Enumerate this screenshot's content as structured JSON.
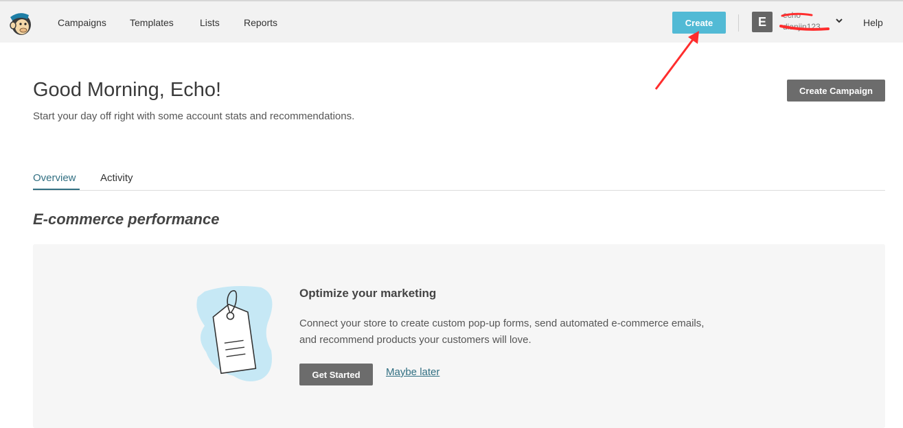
{
  "nav": {
    "logo_icon": "mailchimp-freddie-logo",
    "links": [
      "Campaigns",
      "Templates",
      "Lists",
      "Reports"
    ],
    "create_label": "Create",
    "account": {
      "avatar_initial": "E",
      "name": "echo",
      "username": "dianjin123"
    },
    "help_label": "Help"
  },
  "header": {
    "greeting": "Good Morning, Echo!",
    "subtitle": "Start your day off right with some account stats and recommendations.",
    "create_campaign_label": "Create Campaign"
  },
  "tabs": [
    {
      "label": "Overview",
      "active": true
    },
    {
      "label": "Activity",
      "active": false
    }
  ],
  "section": {
    "title": "E-commerce performance"
  },
  "card": {
    "illustration_icon": "price-tag-icon",
    "heading": "Optimize your marketing",
    "body": "Connect your store to create custom pop-up forms, send automated e-commerce emails, and recommend products your customers will love.",
    "primary_label": "Get Started",
    "secondary_label": "Maybe later"
  },
  "colors": {
    "accent": "#52bad5",
    "link": "#316f82",
    "annotation": "#ff2d2d",
    "dark_button": "#6c6c6c"
  }
}
